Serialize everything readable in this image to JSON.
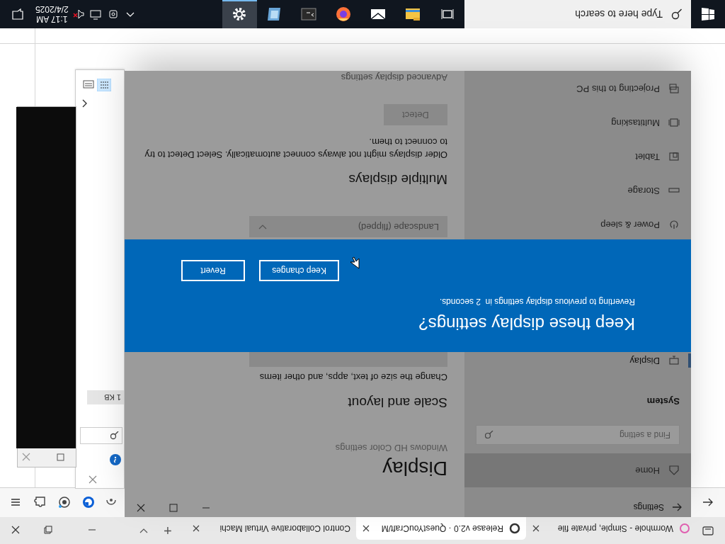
{
  "browser": {
    "tabs": [
      {
        "title": "Wormhole - Simple, private file",
        "selected": false
      },
      {
        "title": "Release v2.0 · QuestYouCraft/M",
        "selected": true
      },
      {
        "title": "Control Collaborative Virtual Machi",
        "selected": false
      }
    ],
    "new_tab": "+"
  },
  "settings": {
    "title": "Settings",
    "home": "Home",
    "search_placeholder": "Find a setting",
    "section": "System",
    "nav_items": [
      {
        "label": "Display",
        "kind": "display",
        "selected": true
      },
      {
        "label": "Power & sleep",
        "kind": "power",
        "selected": false
      },
      {
        "label": "Storage",
        "kind": "storage",
        "selected": false
      },
      {
        "label": "Tablet",
        "kind": "tablet",
        "selected": false
      },
      {
        "label": "Multitasking",
        "kind": "multitasking",
        "selected": false
      },
      {
        "label": "Projecting to this PC",
        "kind": "projecting",
        "selected": false
      }
    ],
    "page_title": "Display",
    "hd_color_link": "Windows HD Color settings",
    "scale_heading": "Scale and layout",
    "scale_text": "Change the size of text, apps, and other items",
    "orientation_value": "Landscape (flipped)",
    "multiple_heading": "Multiple displays",
    "multiple_text": "Older displays might not always connect automatically. Select Detect to try to connect to them.",
    "detect_button": "Detect",
    "advanced_link": "Advanced display settings"
  },
  "dialog": {
    "title": "Keep these display settings?",
    "message": "Reverting to previous display settings in  2 seconds.",
    "buttons": [
      "Keep changes",
      "Revert"
    ]
  },
  "explorer": {
    "size_cell": "1 KB"
  },
  "taskbar": {
    "search_placeholder": "Type here to search",
    "apps": [
      {
        "kind": "explorer",
        "active": false
      },
      {
        "kind": "mail",
        "active": false
      },
      {
        "kind": "firefox",
        "active": false
      },
      {
        "kind": "terminal",
        "active": false
      },
      {
        "kind": "photos",
        "active": false
      },
      {
        "kind": "settings",
        "active": true
      }
    ],
    "time": "1:17 AM",
    "date": "2/4/2025"
  }
}
